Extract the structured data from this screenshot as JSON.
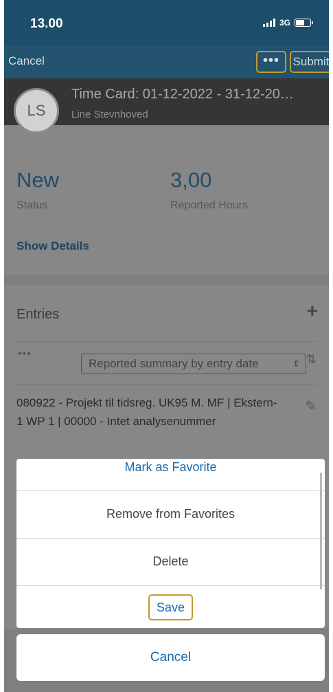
{
  "status_bar": {
    "time": "13.00",
    "network": "3G"
  },
  "nav": {
    "cancel": "Cancel",
    "more": "•••",
    "submit": "Submit"
  },
  "header": {
    "initials": "LS",
    "title": "Time Card: 01-12-2022 - 31-12-20…",
    "subtitle": "Line Stevnhoved"
  },
  "summary": {
    "status_value": "New",
    "status_label": "Status",
    "hours_value": "3,00",
    "hours_label": "Reported Hours",
    "show_details": "Show Details"
  },
  "entries": {
    "title": "Entries",
    "add": "+",
    "more": "•••",
    "filter_value": "Reported summary by entry date",
    "entry_text": "080922 - Projekt til tidsreg. UK95 M. MF | Ekstern-1 WP 1 | 00000 - Intet analysenummer"
  },
  "action_sheet": {
    "items": [
      "Mark as Favorite",
      "Remove from Favorites",
      "Delete",
      "Save"
    ],
    "cancel": "Cancel"
  },
  "colors": {
    "accent_blue": "#1b69a8",
    "highlight_gold": "#c19a2e",
    "header_bar": "#1d4e69"
  }
}
